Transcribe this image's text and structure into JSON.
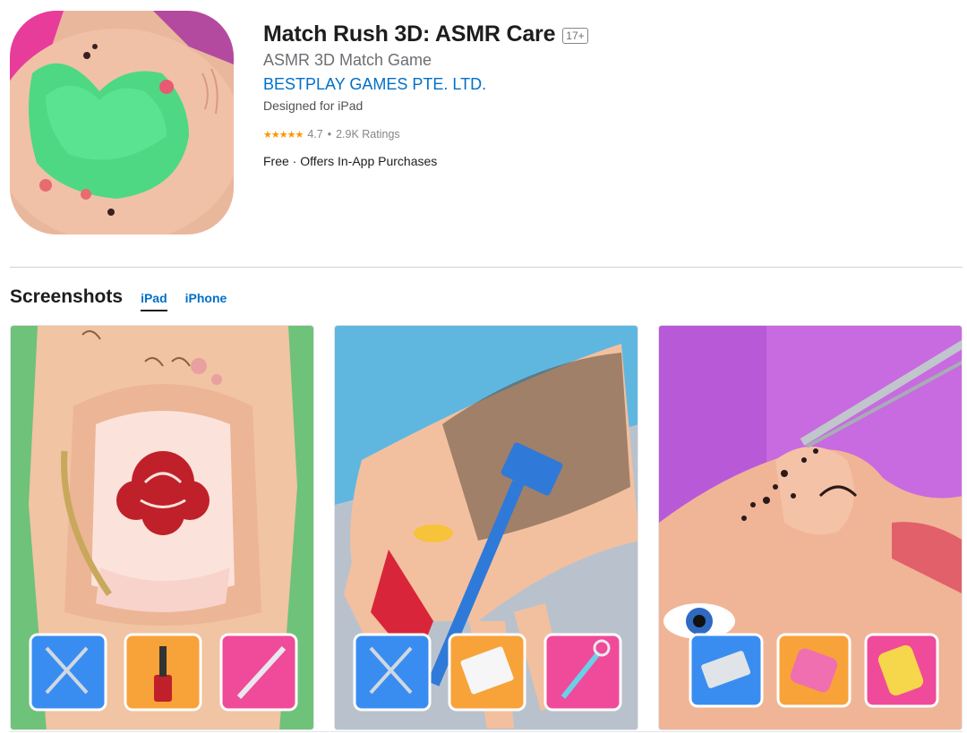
{
  "app": {
    "title": "Match Rush 3D: ASMR Care",
    "age_rating": "17+",
    "subtitle": "ASMR 3D Match Game",
    "developer": "BESTPLAY GAMES PTE. LTD.",
    "designed_for": "Designed for iPad",
    "stars": "★★★★★",
    "rating": "4.7",
    "separator": "•",
    "ratings_count": "2.9K Ratings",
    "price_info": "Free · Offers In-App Purchases"
  },
  "screenshots": {
    "title": "Screenshots",
    "tabs": [
      {
        "label": "iPad",
        "active": true
      },
      {
        "label": "iPhone",
        "active": false
      }
    ],
    "items": [
      {
        "tools": [
          "scissors",
          "nail-polish",
          "nail-file"
        ]
      },
      {
        "tools": [
          "scissors",
          "wax-strip",
          "scraper"
        ]
      },
      {
        "tools": [
          "razor-blade",
          "hair-clipper",
          "thermometer"
        ]
      }
    ]
  },
  "colors": {
    "accent": "#0070c9",
    "star": "#ff9500",
    "tool_blue": "#3a8df0",
    "tool_orange": "#f8a23a",
    "tool_pink": "#f04a9a"
  }
}
